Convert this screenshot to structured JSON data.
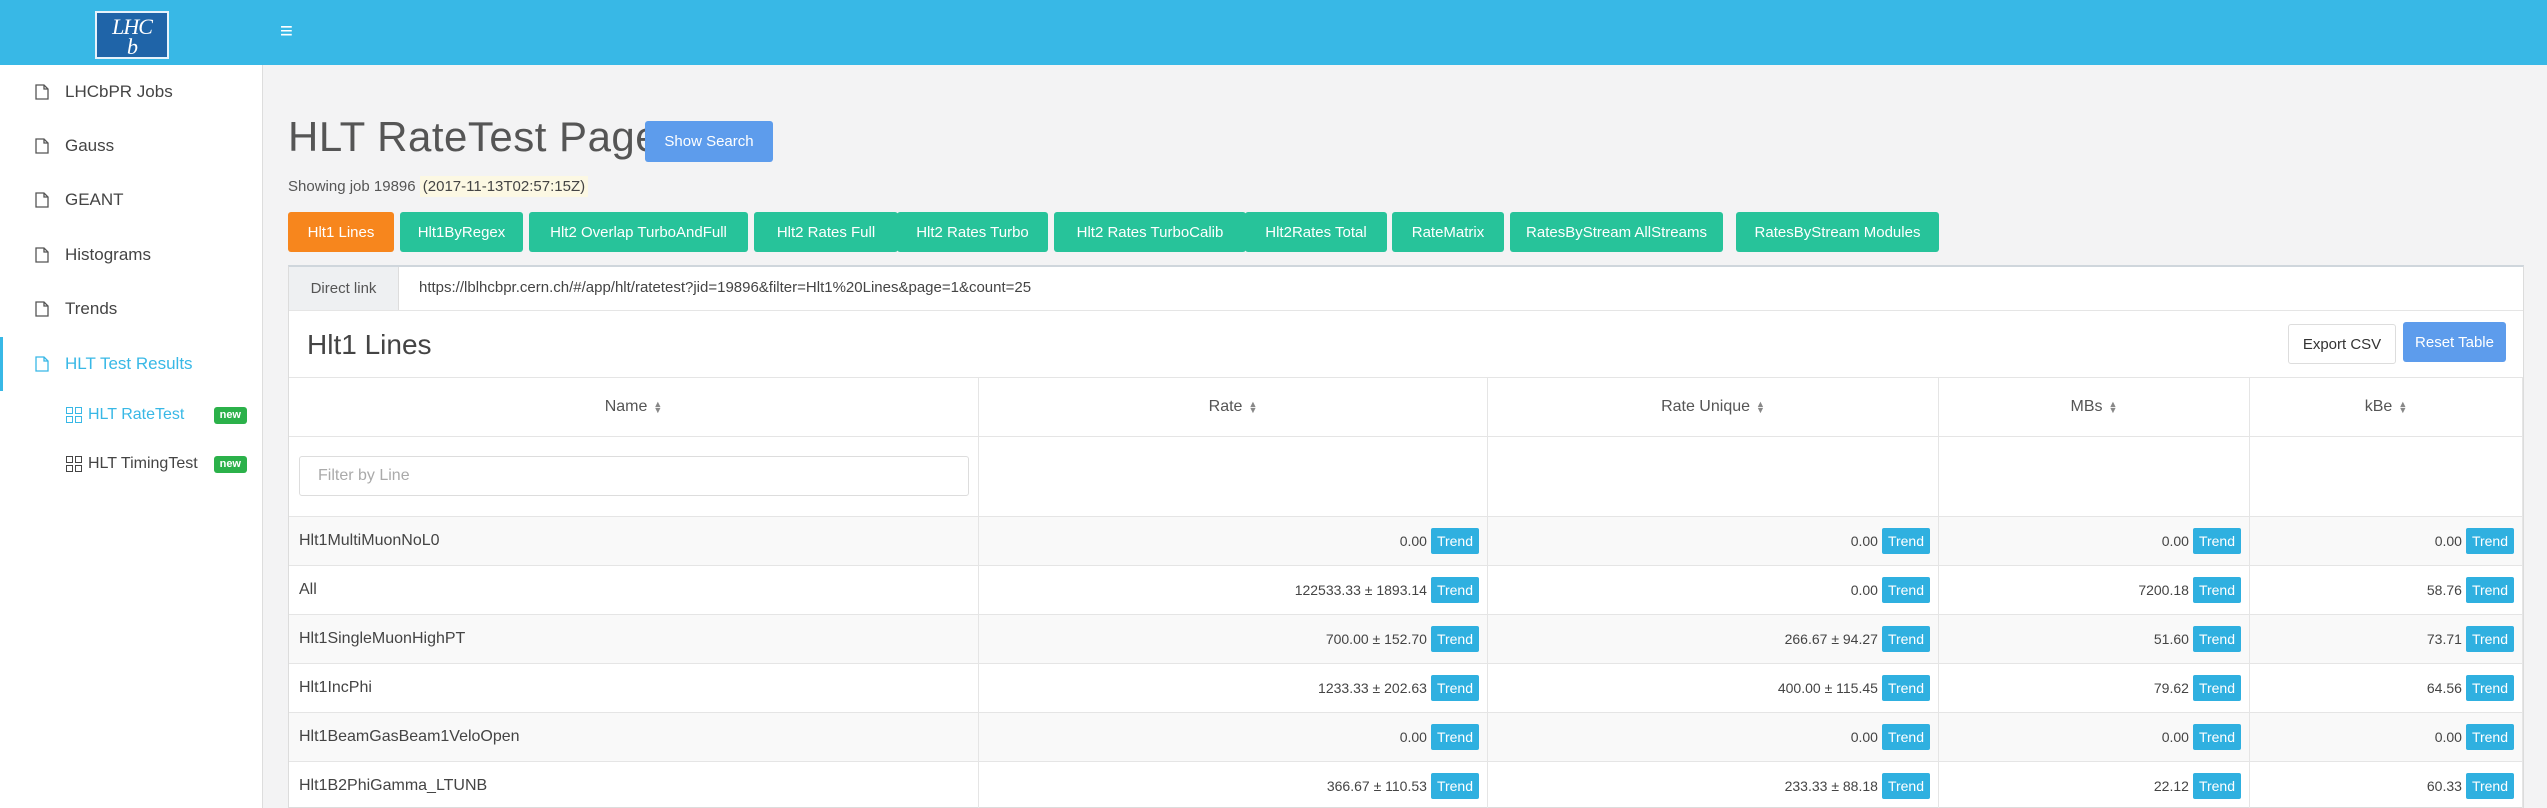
{
  "topbar": {
    "logo_text_top": "LHC",
    "logo_text_bottom": "b",
    "menu_icon": "hamburger-icon"
  },
  "sidebar": {
    "items": [
      {
        "label": "LHCbPR Jobs",
        "icon": "file-icon"
      },
      {
        "label": "Gauss",
        "icon": "file-icon"
      },
      {
        "label": "GEANT",
        "icon": "file-icon"
      },
      {
        "label": "Histograms",
        "icon": "file-icon"
      },
      {
        "label": "Trends",
        "icon": "file-icon"
      },
      {
        "label": "HLT Test Results",
        "icon": "file-icon",
        "active": true
      }
    ],
    "sub_items": [
      {
        "label": "HLT RateTest",
        "badge": "new",
        "active": true
      },
      {
        "label": "HLT TimingTest",
        "badge": "new"
      }
    ]
  },
  "page": {
    "title": "HLT RateTest Page",
    "show_search_label": "Show Search",
    "showing_prefix": "Showing job 19896",
    "showing_time": "(2017-11-13T02:57:15Z)"
  },
  "tabs": [
    {
      "label": "Hlt1 Lines",
      "active": true
    },
    {
      "label": "Hlt1ByRegex"
    },
    {
      "label": "Hlt2 Overlap TurboAndFull"
    },
    {
      "label": "Hlt2 Rates Full"
    },
    {
      "label": "Hlt2 Rates Turbo"
    },
    {
      "label": "Hlt2 Rates TurboCalib"
    },
    {
      "label": "Hlt2Rates Total"
    },
    {
      "label": "RateMatrix"
    },
    {
      "label": "RatesByStream AllStreams"
    },
    {
      "label": "RatesByStream Modules"
    }
  ],
  "panel": {
    "direct_link_label": "Direct link",
    "direct_link_url": "https://lblhcbpr.cern.ch/#/app/hlt/ratetest?jid=19896&filter=Hlt1%20Lines&page=1&count=25",
    "table_title": "Hlt1 Lines",
    "export_label": "Export CSV",
    "reset_label": "Reset Table",
    "filter_placeholder": "Filter by Line",
    "trend_label": "Trend"
  },
  "table": {
    "columns": [
      "Name",
      "Rate",
      "Rate Unique",
      "MBs",
      "kBe"
    ],
    "rows": [
      {
        "name": "Hlt1MultiMuonNoL0",
        "rate": "0.00",
        "rate_unique": "0.00",
        "mbs": "0.00",
        "kbe": "0.00"
      },
      {
        "name": "All",
        "rate": "122533.33 ± 1893.14",
        "rate_unique": "0.00",
        "mbs": "7200.18",
        "kbe": "58.76"
      },
      {
        "name": "Hlt1SingleMuonHighPT",
        "rate": "700.00 ± 152.70",
        "rate_unique": "266.67 ± 94.27",
        "mbs": "51.60",
        "kbe": "73.71"
      },
      {
        "name": "Hlt1IncPhi",
        "rate": "1233.33 ± 202.63",
        "rate_unique": "400.00 ± 115.45",
        "mbs": "79.62",
        "kbe": "64.56"
      },
      {
        "name": "Hlt1BeamGasBeam1VeloOpen",
        "rate": "0.00",
        "rate_unique": "0.00",
        "mbs": "0.00",
        "kbe": "0.00"
      },
      {
        "name": "Hlt1B2PhiGamma_LTUNB",
        "rate": "366.67 ± 110.53",
        "rate_unique": "233.33 ± 88.18",
        "mbs": "22.12",
        "kbe": "60.33"
      }
    ]
  }
}
